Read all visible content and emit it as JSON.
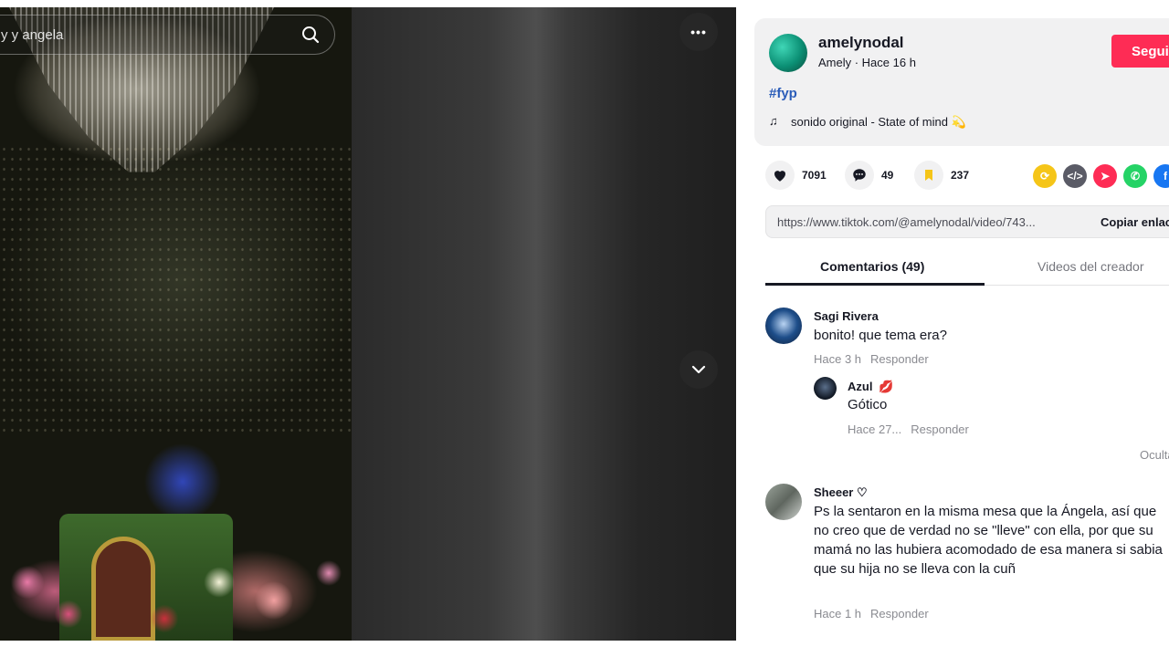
{
  "search": {
    "placeholder": "y y angela"
  },
  "video": {
    "more_label": "•••"
  },
  "author": {
    "username": "amelynodal",
    "meta": "Amely · Hace 16 h",
    "follow_label": "Seguir",
    "hashtag": "#fyp",
    "music": "sonido original - State of mind 💫"
  },
  "actions": {
    "likes": "7091",
    "comments": "49",
    "saves": "237"
  },
  "share_colors": [
    "#f5c518",
    "#5a5b66",
    "#fe2c55",
    "#25d366",
    "#1877f2"
  ],
  "link": {
    "url": "https://www.tiktok.com/@amelynodal/video/743...",
    "copy_label": "Copiar enlace"
  },
  "tabs": {
    "comments": "Comentarios (49)",
    "creator_videos": "Videos del creador"
  },
  "comments": [
    {
      "name": "Sagi Rivera",
      "text": "bonito! que tema era?",
      "time": "Hace 3 h",
      "reply_label": "Responder",
      "replies": [
        {
          "name": "Azul",
          "text": "Gótico",
          "time": "Hace 27...",
          "reply_label": "Responder"
        }
      ]
    },
    {
      "name": "Sheeer ♡",
      "text": "Ps la sentaron en la misma mesa que la Ángela, así que no creo que de verdad no se \"lleve\" con ella, por que su mamá no las hubiera acomodado de esa manera si sabia que su hija no se lleva con la cuñ",
      "time": "Hace 1 h",
      "reply_label": "Responder"
    }
  ],
  "hide_replies_label": "Ocultar"
}
